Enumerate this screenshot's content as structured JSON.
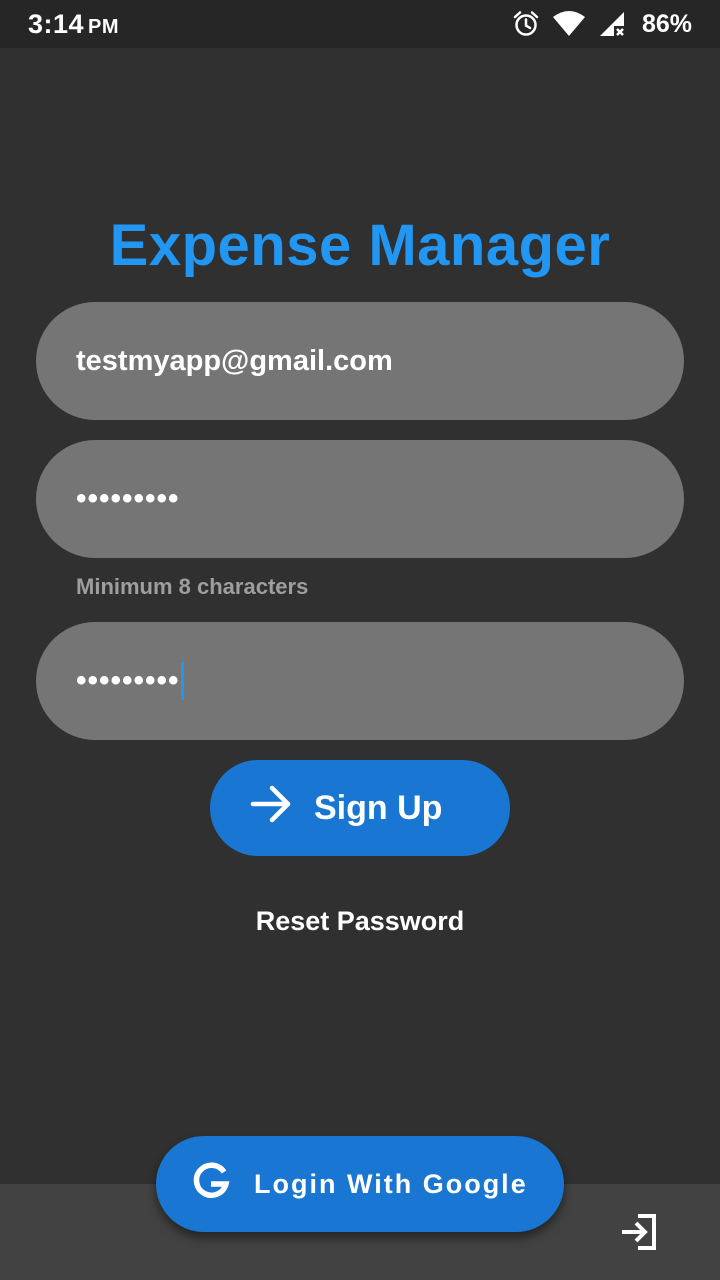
{
  "status_bar": {
    "time": "3:14",
    "ampm": "PM",
    "battery": "86%",
    "icons": [
      "alarm-icon",
      "wifi-icon",
      "signal-icon"
    ]
  },
  "app": {
    "title": "Expense Manager"
  },
  "form": {
    "email_value": "testmyapp@gmail.com",
    "password_value": "•••••••••",
    "password_helper": "Minimum 8 characters",
    "confirm_value": "•••••••••"
  },
  "actions": {
    "signup_label": "Sign Up",
    "signup_icon": "arrow-right-icon",
    "reset_label": "Reset Password",
    "google_label": "Login With Google",
    "google_icon": "google-g-icon",
    "bottom_icon": "login-icon"
  },
  "colors": {
    "background": "#303030",
    "accent": "#2196F3",
    "button": "#1976D2",
    "field": "#757575",
    "bottom_bar": "#424242"
  }
}
